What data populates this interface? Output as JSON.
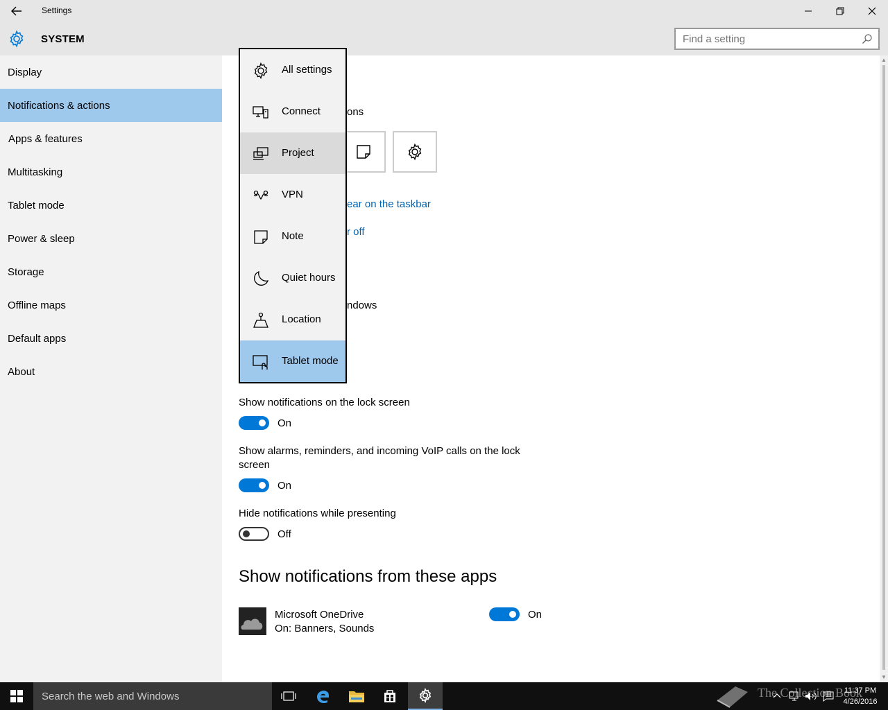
{
  "window": {
    "title": "Settings",
    "section": "SYSTEM",
    "search_placeholder": "Find a setting"
  },
  "sidebar": {
    "items": [
      {
        "label": "Display"
      },
      {
        "label": "Notifications & actions",
        "active": true
      },
      {
        "label": "Apps & features"
      },
      {
        "label": "Multitasking"
      },
      {
        "label": "Tablet mode"
      },
      {
        "label": "Power & sleep"
      },
      {
        "label": "Storage"
      },
      {
        "label": "Offline maps"
      },
      {
        "label": "Default apps"
      },
      {
        "label": "About"
      }
    ]
  },
  "main": {
    "partial_heading": "ons",
    "link_taskbar": "ear on the taskbar",
    "link_off": "r off",
    "partial_windows": "ndows",
    "lock_screen_label": "Show notifications on the lock screen",
    "lock_screen_state": "On",
    "alarms_label_line1": "Show alarms, reminders, and incoming VoIP calls on the lock",
    "alarms_label_line2": "screen",
    "alarms_state": "On",
    "presenting_label": "Hide notifications while presenting",
    "presenting_state": "Off",
    "apps_heading": "Show notifications from these apps",
    "apps": [
      {
        "name": "Microsoft OneDrive",
        "detail": "On: Banners, Sounds",
        "state": "On"
      }
    ]
  },
  "dropdown": {
    "items": [
      {
        "label": "All settings",
        "icon": "gear-icon"
      },
      {
        "label": "Connect",
        "icon": "connect-icon"
      },
      {
        "label": "Project",
        "icon": "project-icon",
        "hover": true
      },
      {
        "label": "VPN",
        "icon": "vpn-icon"
      },
      {
        "label": "Note",
        "icon": "note-icon"
      },
      {
        "label": "Quiet hours",
        "icon": "moon-icon"
      },
      {
        "label": "Location",
        "icon": "location-icon"
      },
      {
        "label": "Tablet mode",
        "icon": "tablet-mode-icon",
        "selected": true
      }
    ]
  },
  "taskbar": {
    "search_placeholder": "Search the web and Windows",
    "time": "11:37 PM",
    "date": "4/26/2016",
    "watermark": "The Collection Book"
  },
  "colors": {
    "accent": "#0078d7",
    "selection": "#9ec8ec",
    "link": "#0063b1",
    "chrome": "#e6e6e6",
    "sidebar": "#f2f2f2"
  }
}
